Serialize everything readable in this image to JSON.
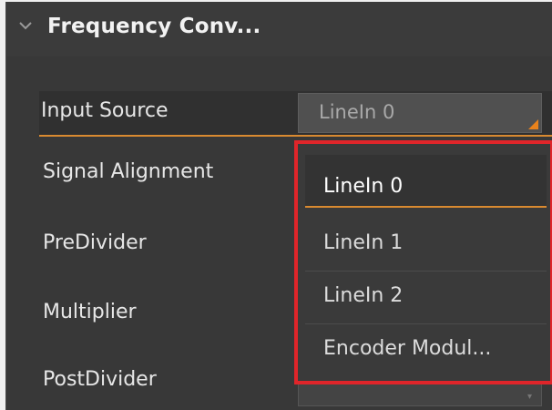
{
  "section": {
    "title": "Frequency Conv...",
    "chevron_icon": "chevron-down-icon"
  },
  "properties": [
    {
      "label": "Input Source"
    },
    {
      "label": "Signal Alignment"
    },
    {
      "label": "PreDivider"
    },
    {
      "label": "Multiplier"
    },
    {
      "label": "PostDivider"
    }
  ],
  "input_source": {
    "value": "LineIn 0"
  },
  "dropdown": {
    "options": [
      "LineIn 0",
      "LineIn 1",
      "LineIn 2",
      "Encoder Modul..."
    ],
    "selected": "LineIn 0"
  },
  "colors": {
    "accent": "#d98a30",
    "highlight_border": "#e0252a",
    "panel_bg": "#383838"
  }
}
